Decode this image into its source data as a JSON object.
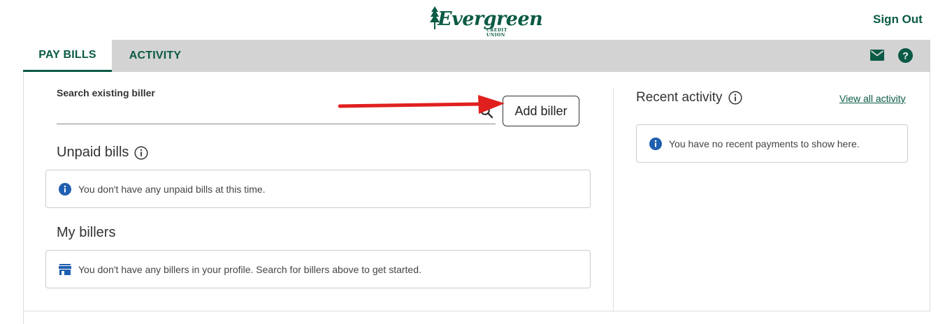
{
  "header": {
    "brand_name": "Evergreen",
    "brand_sub": "CREDIT UNION",
    "sign_out_label": "Sign Out"
  },
  "tabs": [
    {
      "label": "PAY BILLS",
      "active": true
    },
    {
      "label": "ACTIVITY",
      "active": false
    }
  ],
  "toolbar_icons": [
    "mail-icon",
    "help-icon"
  ],
  "search": {
    "label": "Search existing biller",
    "value": "",
    "placeholder": ""
  },
  "add_biller_label": "Add biller",
  "unpaid_bills": {
    "title": "Unpaid bills",
    "message": "You don't have any unpaid bills at this time."
  },
  "my_billers": {
    "title": "My billers",
    "message": "You don't have any billers in your profile. Search for billers above to get started."
  },
  "recent_activity": {
    "title": "Recent activity",
    "view_all_label": "View all activity",
    "message": "You have no recent payments to show here."
  },
  "colors": {
    "brand_green": "#0b5a45",
    "tab_bar": "#d3d3d3",
    "info_blue": "#1f5fb0",
    "annotation_red": "#e0201f"
  }
}
